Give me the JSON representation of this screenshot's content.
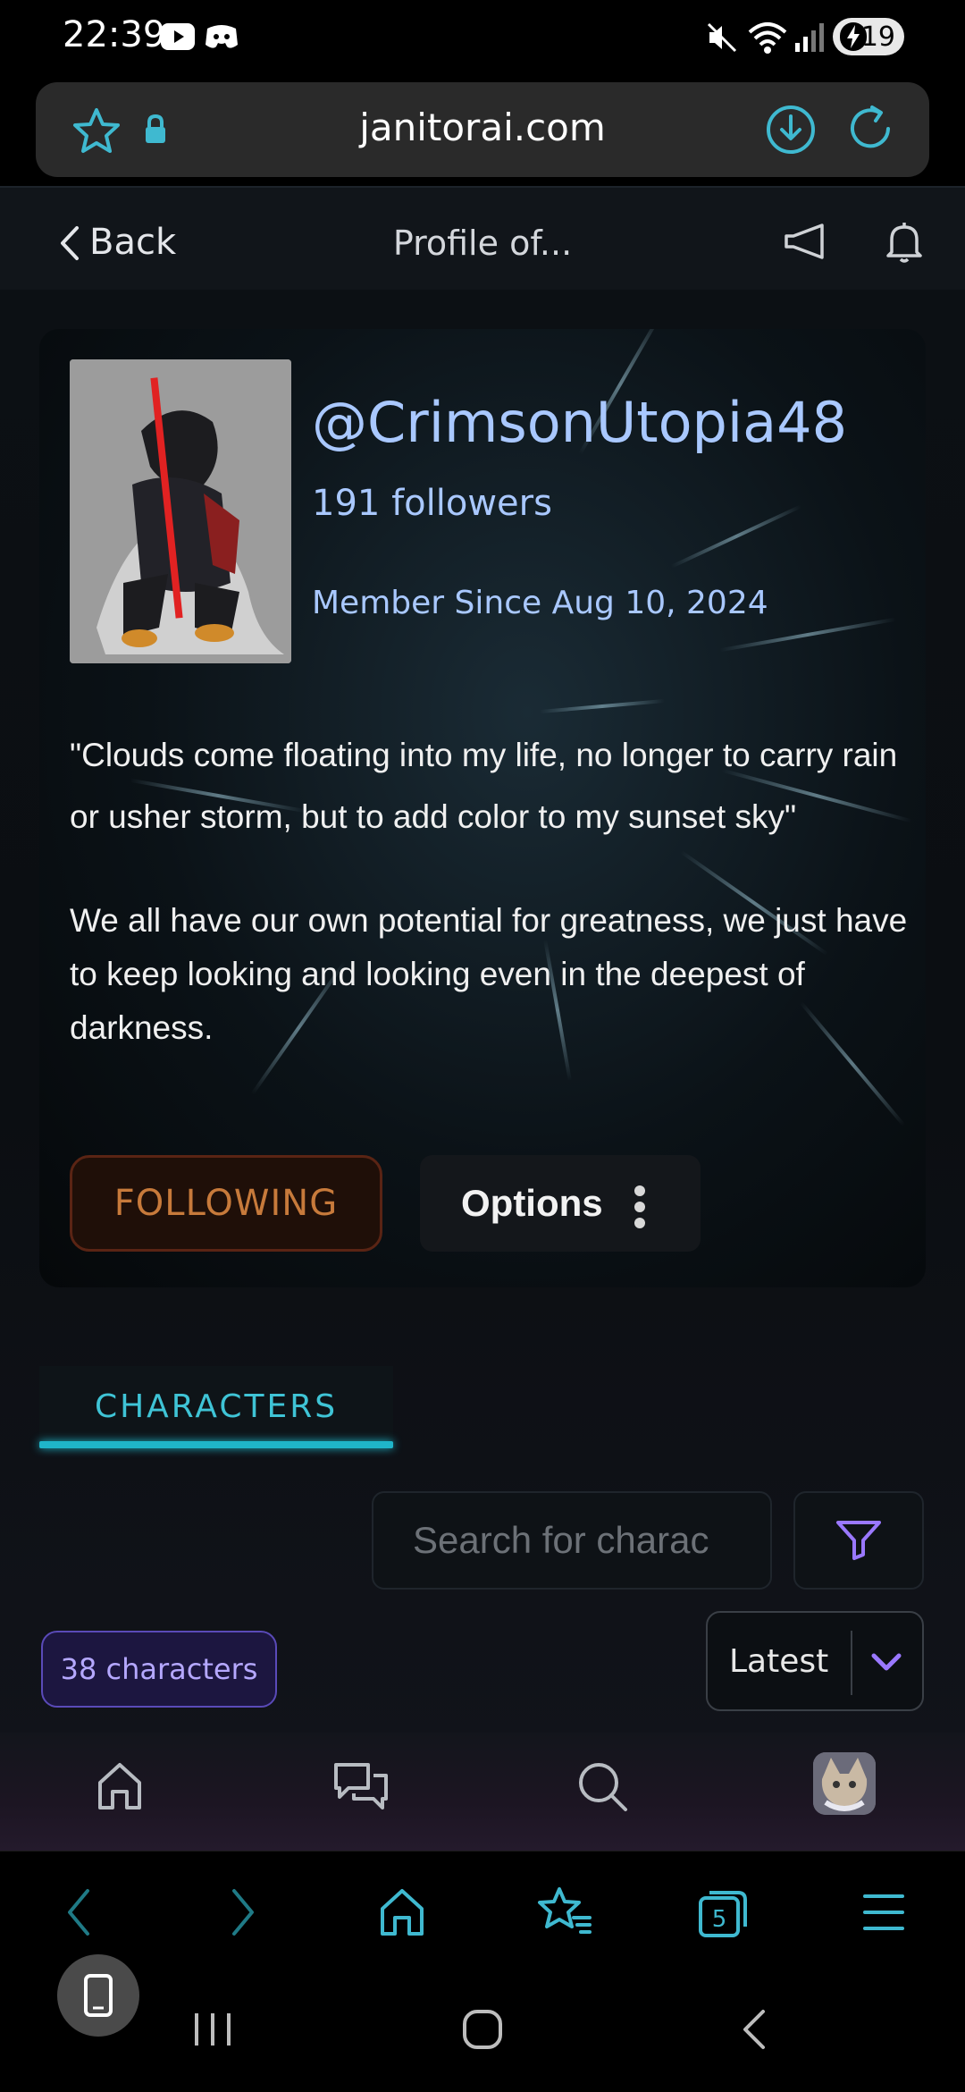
{
  "status_bar": {
    "time": "22:39",
    "battery": "19",
    "icons": [
      "youtube-icon",
      "discord-icon",
      "mute-icon",
      "wifi-icon",
      "signal-icon",
      "battery-icon"
    ]
  },
  "browser": {
    "url": "janitorai.com",
    "icons": [
      "star-icon",
      "lock-icon",
      "download-icon",
      "reload-icon"
    ]
  },
  "top_nav": {
    "back_label": "Back",
    "title": "Profile of..."
  },
  "profile": {
    "handle": "@CrimsonUtopia48",
    "followers": "191 followers",
    "member_since": "Member Since Aug 10, 2024",
    "quote": "\"Clouds come floating into my life, no longer to carry rain or usher storm, but to add color to my sunset sky\"",
    "bio": "We all have our own potential for greatness, we just have to keep looking and looking even in the deepest of darkness.",
    "following_label": "FOLLOWING",
    "options_label": "Options"
  },
  "tabs": {
    "characters_label": "CHARACTERS"
  },
  "search": {
    "placeholder": "Search for charac"
  },
  "character_count": "38 characters",
  "sort": {
    "selected": "Latest"
  },
  "browser_toolbar": {
    "tabs_count": "5"
  },
  "colors": {
    "accent_cyan": "#1fb5c9",
    "handle_blue": "#a9c8ff",
    "following_orange": "#c77a3b",
    "count_purple": "#b5a8ff"
  }
}
